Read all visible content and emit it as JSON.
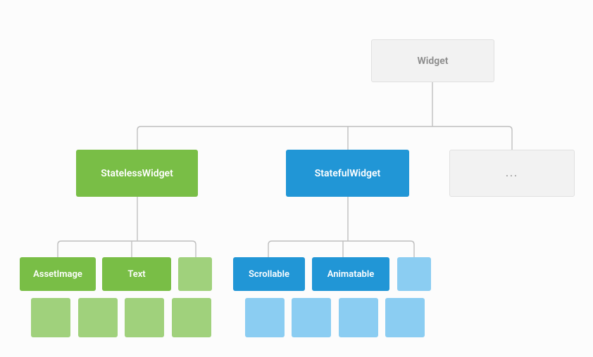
{
  "diagram": {
    "root": {
      "label": "Widget"
    },
    "level1": {
      "stateless": {
        "label": "StatelessWidget"
      },
      "stateful": {
        "label": "StatefulWidget"
      },
      "more": {
        "label": "..."
      }
    },
    "stateless_children": {
      "asset_image": {
        "label": "AssetImage"
      },
      "text": {
        "label": "Text"
      }
    },
    "stateful_children": {
      "scrollable": {
        "label": "Scrollable"
      },
      "animatable": {
        "label": "Animatable"
      }
    }
  },
  "colors": {
    "green_main": "#79be46",
    "green_faded": "#a0d17c",
    "blue_main": "#2196d6",
    "blue_faded": "#8bcdf2",
    "gray_bg": "#f2f2f2",
    "gray_border": "#e0e0e0",
    "line": "#bfbfbf"
  }
}
